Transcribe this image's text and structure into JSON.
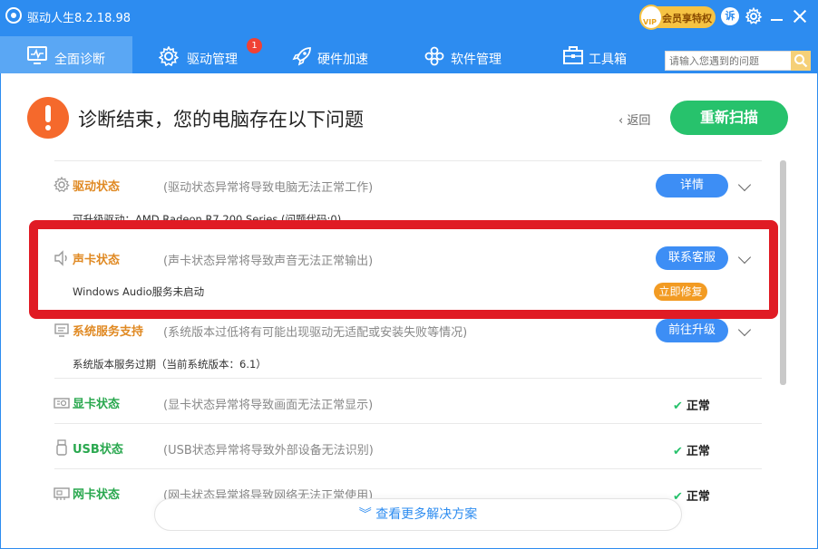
{
  "app": {
    "title": "驱动人生8.2.18.98",
    "vip_label": "会员享特权",
    "vip_circle_text": "VIP",
    "cs_label": "诉"
  },
  "nav": {
    "tabs": [
      {
        "label": "全面诊断",
        "active": true
      },
      {
        "label": "驱动管理",
        "badge": "1"
      },
      {
        "label": "硬件加速"
      },
      {
        "label": "软件管理"
      },
      {
        "label": "工具箱"
      }
    ],
    "search_placeholder": "请输入您遇到的问题"
  },
  "header": {
    "title": "诊断结束，您的电脑存在以下问题",
    "back_label": "返回",
    "rescan_label": "重新扫描"
  },
  "rows": [
    {
      "title": "驱动状态",
      "desc": "(驱动状态异常将导致电脑无法正常工作)",
      "action": "详情",
      "detail": "可升级驱动：AMD Radeon R7 200 Series (问题代码:0)"
    },
    {
      "title": "声卡状态",
      "desc": "(声卡状态异常将导致声音无法正常输出)",
      "action": "联系客服",
      "detail": "Windows Audio服务未启动",
      "fix_label": "立即修复"
    },
    {
      "title": "系统服务支持",
      "desc": "(系统版本过低将有可能出现驱动无适配或安装失败等情况)",
      "action": "前往升级",
      "detail": "系统版本服务过期（当前系统版本：6.1）"
    },
    {
      "title": "显卡状态",
      "desc": "(显卡状态异常将导致画面无法正常显示)",
      "status": "正常"
    },
    {
      "title": "USB状态",
      "desc": "(USB状态异常将导致外部设备无法识别)",
      "status": "正常"
    },
    {
      "title": "网卡状态",
      "desc": "(网卡状态异常将导致网络无法正常使用)",
      "status": "正常"
    }
  ],
  "footer": {
    "more_label": "查看更多解决方案"
  },
  "colors": {
    "primary": "#2d8cf0",
    "rescan_green": "#27c26c",
    "alert_orange": "#f5692c",
    "highlight_red": "#e01b24"
  }
}
